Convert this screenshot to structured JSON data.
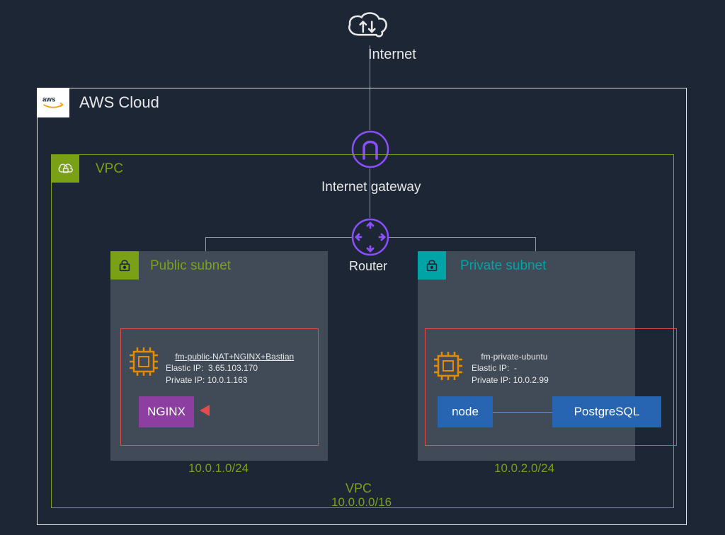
{
  "internet": {
    "label": "Internet"
  },
  "aws": {
    "title": "AWS Cloud"
  },
  "vpc": {
    "title": "VPC",
    "bottom_label": "VPC",
    "cidr": "10.0.0.0/16"
  },
  "igw": {
    "label": "Internet gateway"
  },
  "router": {
    "label": "Router"
  },
  "subnets": {
    "public": {
      "title": "Public subnet",
      "cidr": "10.0.1.0/24",
      "instance": {
        "name": "fm-public-NAT+NGINX+Bastian",
        "elastic_ip_label": "Elastic IP:",
        "elastic_ip": "3.65.103.170",
        "private_ip_label": "Private IP:",
        "private_ip": "10.0.1.163"
      },
      "services": {
        "nginx": "NGINX"
      }
    },
    "private": {
      "title": "Private subnet",
      "cidr": "10.0.2.0/24",
      "instance": {
        "name": "fm-private-ubuntu",
        "elastic_ip_label": "Elastic IP:",
        "elastic_ip": "-",
        "private_ip_label": "Private IP:",
        "private_ip": "10.0.2.99"
      },
      "services": {
        "node": "node",
        "postgresql": "PostgreSQL"
      }
    }
  }
}
